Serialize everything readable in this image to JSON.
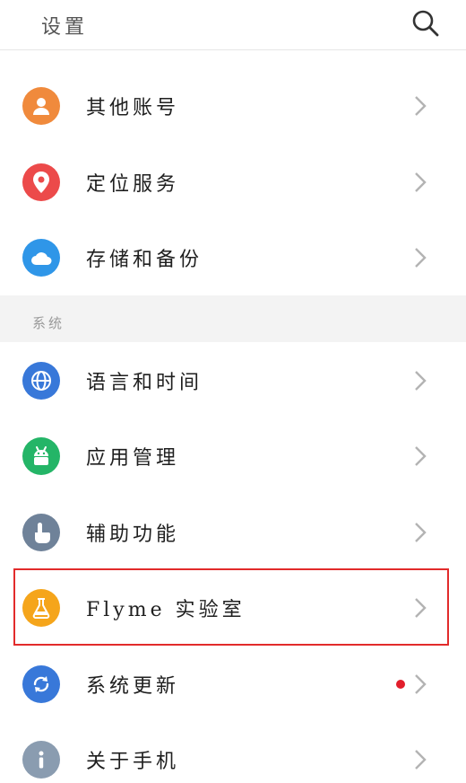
{
  "header": {
    "title": "设置",
    "search_icon": "search-icon"
  },
  "accounts": [
    {
      "name": "other-accounts",
      "label": "其他账号",
      "icon": "person-icon",
      "color": "#f08a3c"
    },
    {
      "name": "location",
      "label": "定位服务",
      "icon": "location-pin-icon",
      "color": "#ec4a4a"
    },
    {
      "name": "storage-backup",
      "label": "存储和备份",
      "icon": "cloud-icon",
      "color": "#2f96e8"
    }
  ],
  "section": {
    "title": "系统"
  },
  "system": [
    {
      "name": "language-time",
      "label": "语言和时间",
      "icon": "globe-icon",
      "color": "#3878d9"
    },
    {
      "name": "app-management",
      "label": "应用管理",
      "icon": "android-icon",
      "color": "#24b567"
    },
    {
      "name": "accessibility",
      "label": "辅助功能",
      "icon": "hand-pointer-icon",
      "color": "#6f8299"
    },
    {
      "name": "flyme-lab",
      "label": "Flyme 实验室",
      "icon": "flask-icon",
      "color": "#f5a51b"
    },
    {
      "name": "system-update",
      "label": "系统更新",
      "icon": "refresh-icon",
      "color": "#3878d9",
      "badge_color": "#e21e2b"
    },
    {
      "name": "about-phone",
      "label": "关于手机",
      "icon": "info-icon",
      "color": "#8a9cb0"
    }
  ],
  "colors": {
    "highlight": "#e22b2b",
    "chevron": "#b3b3b3"
  }
}
